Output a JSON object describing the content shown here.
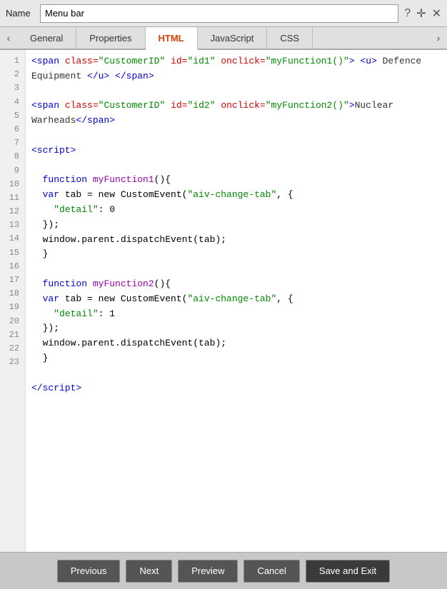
{
  "header": {
    "name_label": "Name",
    "input_value": "Menu bar",
    "icons": [
      "?",
      "✛",
      "✕"
    ]
  },
  "tabs": [
    {
      "label": "General",
      "active": false
    },
    {
      "label": "Properties",
      "active": false
    },
    {
      "label": "HTML",
      "active": true
    },
    {
      "label": "JavaScript",
      "active": false
    },
    {
      "label": "CSS",
      "active": false
    }
  ],
  "line_numbers": [
    1,
    2,
    3,
    4,
    5,
    6,
    7,
    8,
    9,
    10,
    11,
    12,
    13,
    14,
    15,
    16,
    17,
    18,
    19,
    20,
    21,
    22,
    23
  ],
  "footer": {
    "previous_label": "Previous",
    "next_label": "Next",
    "preview_label": "Preview",
    "cancel_label": "Cancel",
    "save_exit_label": "Save and Exit"
  }
}
